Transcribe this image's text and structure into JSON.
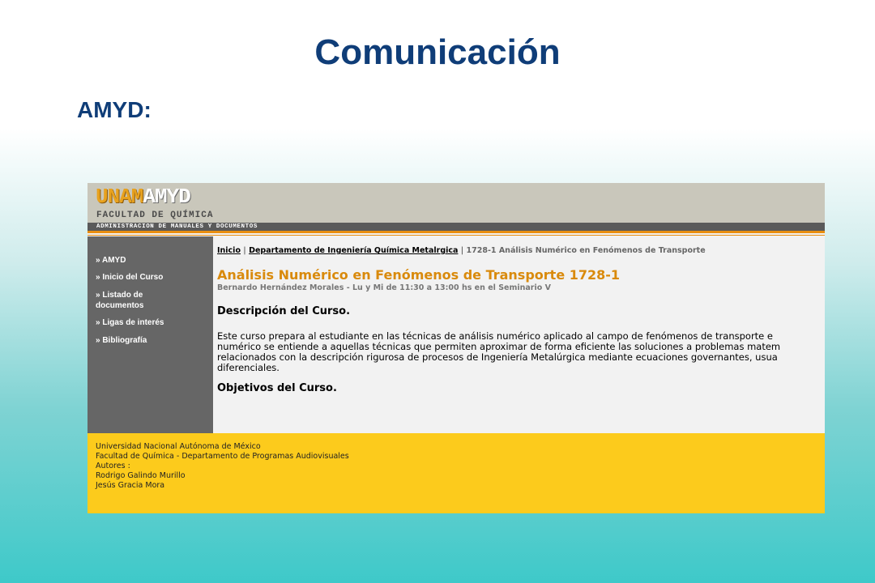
{
  "slide": {
    "title": "Comunicación",
    "subtitle": "AMYD:"
  },
  "site": {
    "logo_unam": "UNAM",
    "logo_amyd": "AMYD",
    "faculty": "FACULTAD DE QUÍMICA",
    "tagline": "ADMINISTRACION DE MANUALES Y DOCUMENTOS"
  },
  "sidebar": {
    "items": [
      {
        "label": "» AMYD"
      },
      {
        "label": "» Inicio del Curso"
      },
      {
        "label": "» Listado de documentos"
      },
      {
        "label": "» Ligas de interés"
      },
      {
        "label": "» Bibliografía"
      }
    ]
  },
  "breadcrumb": {
    "home": "Inicio",
    "sep1": " | ",
    "department": "Departamento de Ingeniería Química Metalrgica",
    "sep2": " | ",
    "current": "1728-1 Análisis Numérico en Fenómenos de Transporte"
  },
  "course": {
    "title": "Análisis Numérico en Fenómenos de Transporte 1728-1",
    "subtitle": "Bernardo Hernández Morales - Lu y Mi de 11:30 a 13:00 hs en el Seminario V",
    "description_heading": "Descripción del Curso.",
    "description_lines": [
      "Este curso prepara al estudiante en las técnicas de análisis numérico aplicado al campo de fenómenos de transporte e",
      "numérico se entiende a aquellas técnicas que permiten aproximar de forma eficiente las soluciones a problemas matem",
      "relacionados con la descripción rigurosa de procesos de Ingeniería Metalúrgica mediante ecuaciones governantes, usua",
      "diferenciales."
    ],
    "objectives_heading": "Objetivos del Curso."
  },
  "footer": {
    "lines": [
      "Universidad Nacional Autónoma de México",
      "Facultad de Química - Departamento de Programas Audiovisuales",
      "Autores :",
      "Rodrigo Galindo Murillo",
      "Jesús Gracia Mora"
    ]
  },
  "colors": {
    "title_blue": "#0f3d78",
    "course_orange": "#d98a0c",
    "sidebar_gray": "#666666",
    "footer_yellow": "#fccb1c"
  }
}
